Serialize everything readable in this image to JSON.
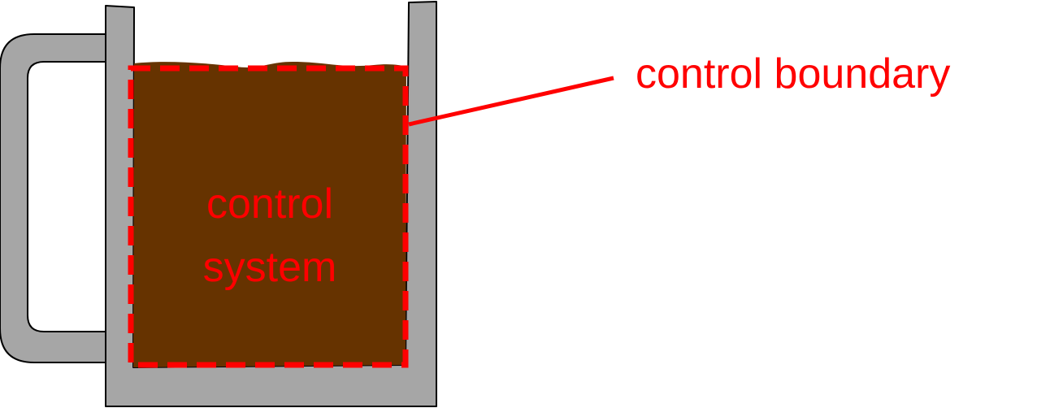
{
  "diagram": {
    "inner_label_line1": "control",
    "inner_label_line2": "system",
    "callout_label": "control boundary"
  },
  "colors": {
    "background": "#ffffff",
    "mug": "#a6a6a6",
    "outline": "#000000",
    "liquid": "#663300",
    "boundary": "#ff0000"
  }
}
